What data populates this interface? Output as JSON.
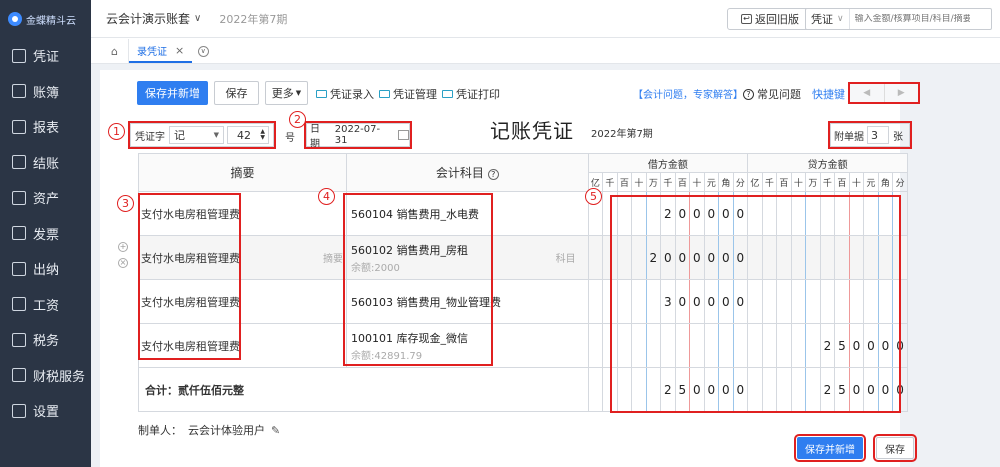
{
  "sidebar": {
    "logo_text": "金蝶精斗云",
    "items": [
      "凭证",
      "账簿",
      "报表",
      "结账",
      "资产",
      "发票",
      "出纳",
      "工资",
      "税务",
      "财税服务",
      "设置"
    ]
  },
  "topbar": {
    "account_name": "云会计演示账套",
    "period": "2022年第7期",
    "old_version_button": "返回旧版",
    "search_type": "凭证",
    "search_placeholder": "输入金额/核算项目/科目/摘要"
  },
  "tabs": {
    "active_tab": "录凭证"
  },
  "toolbar": {
    "save_new": "保存并新增",
    "save": "保存",
    "more": "更多",
    "voucher_entry": "凭证录入",
    "voucher_manage": "凭证管理",
    "voucher_print": "凭证打印",
    "help_link": "【会计问题，专家解答】",
    "faq": "常见问题",
    "shortcuts": "快捷键"
  },
  "voucher": {
    "word_label": "凭证字",
    "word_value": "记",
    "number_value": "42",
    "number_suffix": "号",
    "date_label": "日期",
    "date_value": "2022-07-31",
    "title": "记账凭证",
    "period": "2022年第7期",
    "attach_label": "附单据",
    "attach_value": "3",
    "attach_unit": "张"
  },
  "table": {
    "col_summary": "摘要",
    "col_account": "会计科目",
    "col_debit": "借方金额",
    "col_credit": "贷方金额",
    "units": [
      "亿",
      "千",
      "百",
      "十",
      "万",
      "千",
      "百",
      "十",
      "元",
      "角",
      "分"
    ],
    "summary_hint": "摘要",
    "account_hint": "科目",
    "rows": [
      {
        "summary": "支付水电房租管理费",
        "account": "560104 销售费用_水电费",
        "balance": "",
        "debit": "200000",
        "credit": ""
      },
      {
        "summary": "支付水电房租管理费",
        "account": "560102 销售费用_房租",
        "balance": "余额:2000",
        "debit": "2000000",
        "credit": ""
      },
      {
        "summary": "支付水电房租管理费",
        "account": "560103 销售费用_物业管理费",
        "balance": "",
        "debit": "300000",
        "credit": ""
      },
      {
        "summary": "支付水电房租管理费",
        "account": "100101 库存现金_微信",
        "balance": "余额:42891.79",
        "debit": "",
        "credit": "250000"
      }
    ],
    "total_label": "合计：贰仟伍佰元整",
    "total_debit": "250000",
    "total_credit": "250000"
  },
  "footer": {
    "maker_label": "制单人：",
    "maker_value": "云会计体验用户",
    "save_new": "保存并新增",
    "save": "保存"
  },
  "annotations": [
    "1",
    "2",
    "3",
    "4",
    "5"
  ]
}
